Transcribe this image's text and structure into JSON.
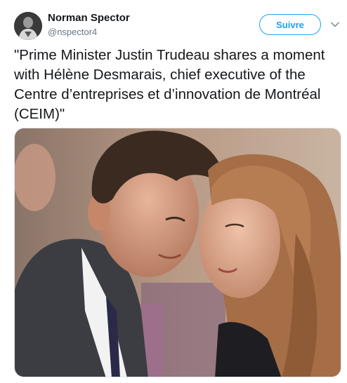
{
  "author": {
    "name": "Norman Spector",
    "handle": "@nspector4"
  },
  "follow_label": "Suivre",
  "tweet_text": "\"Prime Minister Justin Trudeau shares a moment with Hélène Desmarais, chief executive of the Centre d’entreprises et d’innovation de Montréal (CEIM)\"",
  "icons": {
    "more": "chevron-down-icon",
    "avatar": "profile-photo"
  },
  "colors": {
    "accent": "#1da1f2",
    "text": "#14171a",
    "muted": "#657786"
  }
}
